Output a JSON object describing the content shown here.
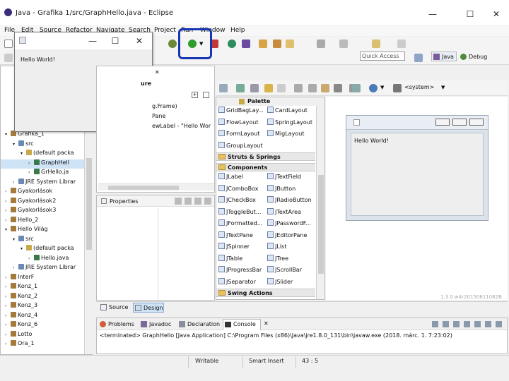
{
  "window": {
    "title": "Java - Grafika 1/src/GraphHello.java - Eclipse",
    "minimize": "—",
    "maximize": "☐",
    "close": "✕"
  },
  "menu": [
    "File",
    "Edit",
    "Source",
    "Refactor",
    "Navigate",
    "Search",
    "Project",
    "Run",
    "Window",
    "Help"
  ],
  "toolbar": {
    "quick_access_placeholder": "Quick Access",
    "java_perspective": "Java",
    "debug_perspective": "Debug",
    "system_laf": "<system>"
  },
  "floating_window": {
    "minimize": "—",
    "maximize": "☐",
    "close": "✕",
    "content": "Hello World!"
  },
  "explorer": {
    "items": [
      {
        "label": "Grafika_1",
        "indent": 0,
        "expanded": true
      },
      {
        "label": "src",
        "indent": 1,
        "expanded": true
      },
      {
        "label": "(default packa",
        "indent": 2,
        "expanded": true
      },
      {
        "label": "GraphHell",
        "indent": 3,
        "selected": true
      },
      {
        "label": "GrHello.ja",
        "indent": 3
      },
      {
        "label": "JRE System Librar",
        "indent": 1
      },
      {
        "label": "Gyakorlások",
        "indent": 0
      },
      {
        "label": "Gyakorlások2",
        "indent": 0
      },
      {
        "label": "Gyakorlások3",
        "indent": 0
      },
      {
        "label": "Hello_2",
        "indent": 0
      },
      {
        "label": "Hello Világ",
        "indent": 0,
        "expanded": true
      },
      {
        "label": "src",
        "indent": 1,
        "expanded": true
      },
      {
        "label": "(default packa",
        "indent": 2,
        "expanded": true
      },
      {
        "label": "Hello.java",
        "indent": 3
      },
      {
        "label": "JRE System Librar",
        "indent": 1
      },
      {
        "label": "InterF",
        "indent": 0
      },
      {
        "label": "Konz_1",
        "indent": 0
      },
      {
        "label": "Konz_2",
        "indent": 0
      },
      {
        "label": "Konz_3",
        "indent": 0
      },
      {
        "label": "Konz_4",
        "indent": 0
      },
      {
        "label": "Konz_6",
        "indent": 0
      },
      {
        "label": "Lotto",
        "indent": 0
      },
      {
        "label": "Ora_1",
        "indent": 0
      }
    ]
  },
  "components": {
    "header": "ure",
    "items": [
      "g.Frame)",
      "Pane",
      "ewLabel - \"Hello Wor"
    ]
  },
  "properties": {
    "tab": "Properties"
  },
  "palette": {
    "title": "Palette",
    "layouts": [
      "GridBagLay...",
      "CardLayout",
      "FlowLayout",
      "SpringLayout",
      "FormLayout",
      "MigLayout",
      "GroupLayout"
    ],
    "struts_header": "Struts & Springs",
    "components_header": "Components",
    "components": [
      "JLabel",
      "JTextField",
      "JComboBox",
      "JButton",
      "JCheckBox",
      "JRadioButton",
      "JToggleBut...",
      "JTextArea",
      "JFormatted...",
      "JPasswordF...",
      "JTextPane",
      "JEditorPane",
      "JSpinner",
      "JList",
      "JTable",
      "JTree",
      "JProgressBar",
      "JScrollBar",
      "JSeparator",
      "JSlider"
    ],
    "swing_actions_header": "Swing Actions"
  },
  "design_preview": {
    "content": "Hello World!",
    "watermark": "1.3.0.w4r20150611082B"
  },
  "editor_tabs": {
    "source": "Source",
    "design": "Design"
  },
  "bottom_tabs": [
    "Problems",
    "Javadoc",
    "Declaration",
    "Console"
  ],
  "console": {
    "text": "<terminated> GraphHello [Java Application] C:\\Program Files (x86)\\Java\\jre1.8.0_131\\bin\\javaw.exe (2018. márc. 1. 7:23:02)"
  },
  "status": {
    "writable": "Writable",
    "insert": "Smart Insert",
    "position": "43 : 5"
  },
  "colors": {
    "highlight": "#1836b3",
    "selection": "#cfe3f7",
    "run_green": "#2e9c2e"
  }
}
